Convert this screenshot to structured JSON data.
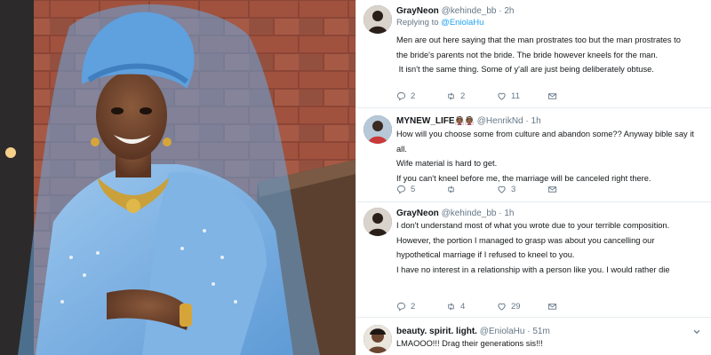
{
  "tweets": [
    {
      "name": "GrayNeon",
      "handle": "@kehinde_bb",
      "time": "2h",
      "reply_prefix": "Replying to ",
      "reply_handle": "@EniolaHu",
      "lines": [
        "Men are out here saying that the man prostrates too but the man prostrates to",
        "the bride's parents not the bride. The bride however kneels for the man.",
        "",
        " It isn't the same thing. Some of y'all are just being deliberately obtuse."
      ],
      "replies": "2",
      "retweets": "2",
      "likes": "11"
    },
    {
      "name": "MYNEW_LIFE",
      "name_emoji": "👰🏾👰🏾",
      "handle": "@HenrikNd",
      "time": "1h",
      "lines": [
        "How will you choose some from culture and abandon some?? Anyway bible say it",
        "all.",
        "Wife material is hard to get.",
        "If you can't kneel before me, the marriage will be canceled right there."
      ],
      "replies": "5",
      "retweets": "",
      "likes": "3"
    },
    {
      "name": "GrayNeon",
      "handle": "@kehinde_bb",
      "time": "1h",
      "lines": [
        "I don't understand most of what you wrote due to your terrible composition.",
        "",
        "However, the portion I managed to grasp was about you cancelling our",
        "hypothetical marriage if I refused to kneel to you.",
        "",
        "I have no interest in a relationship with a person like you. I would rather die"
      ],
      "replies": "2",
      "retweets": "4",
      "likes": "29"
    },
    {
      "name": "beauty. spirit. light.",
      "handle": "@EniolaHu",
      "time": "51m",
      "lines": [
        "LMAOOO!!! Drag their generations sis!!!"
      ]
    }
  ],
  "separator": "·",
  "icons": {
    "reply": "reply-icon",
    "retweet": "retweet-icon",
    "like": "heart-icon",
    "dm": "envelope-icon",
    "more": "chevron-down-icon"
  },
  "colors": {
    "muted": "#657786",
    "link": "#1da1f2",
    "divider": "#e6ecf0",
    "gown_blue": "#7fb4e4"
  }
}
